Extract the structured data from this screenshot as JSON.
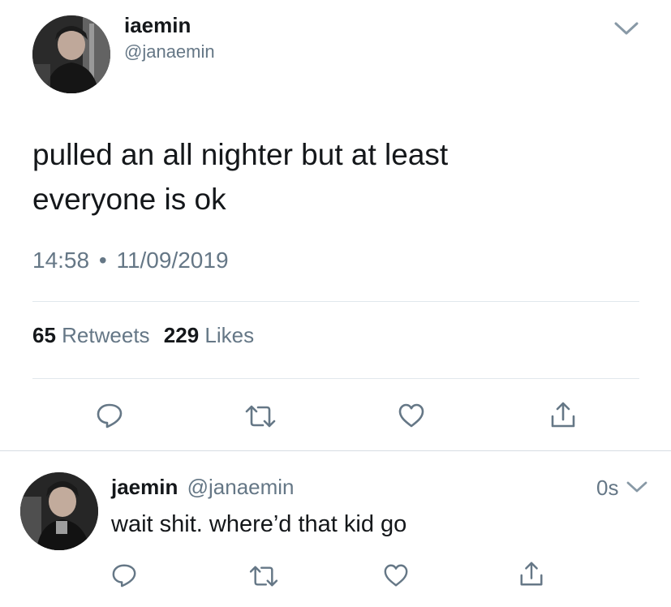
{
  "main_tweet": {
    "display_name": "iaemin",
    "handle": "@janaemin",
    "text_line1": "pulled an all nighter but at least",
    "text_line2": "everyone is ok",
    "time": "14:58",
    "dot": "•",
    "date": "11/09/2019",
    "retweets_count": "65",
    "retweets_label": "Retweets",
    "likes_count": "229",
    "likes_label": "Likes",
    "icons": [
      "reply-icon",
      "retweet-icon",
      "like-icon",
      "share-icon",
      "chevron-down-icon"
    ]
  },
  "reply_tweet": {
    "display_name": "jaemin",
    "handle": "@janaemin",
    "age": "0s",
    "text": "wait shit. where’d that kid go",
    "icons": [
      "reply-icon",
      "retweet-icon",
      "like-icon",
      "share-icon",
      "chevron-down-icon"
    ]
  },
  "colors": {
    "text": "#14171a",
    "muted": "#657786",
    "icon": "#657786",
    "divider": "#e1e8ed"
  }
}
